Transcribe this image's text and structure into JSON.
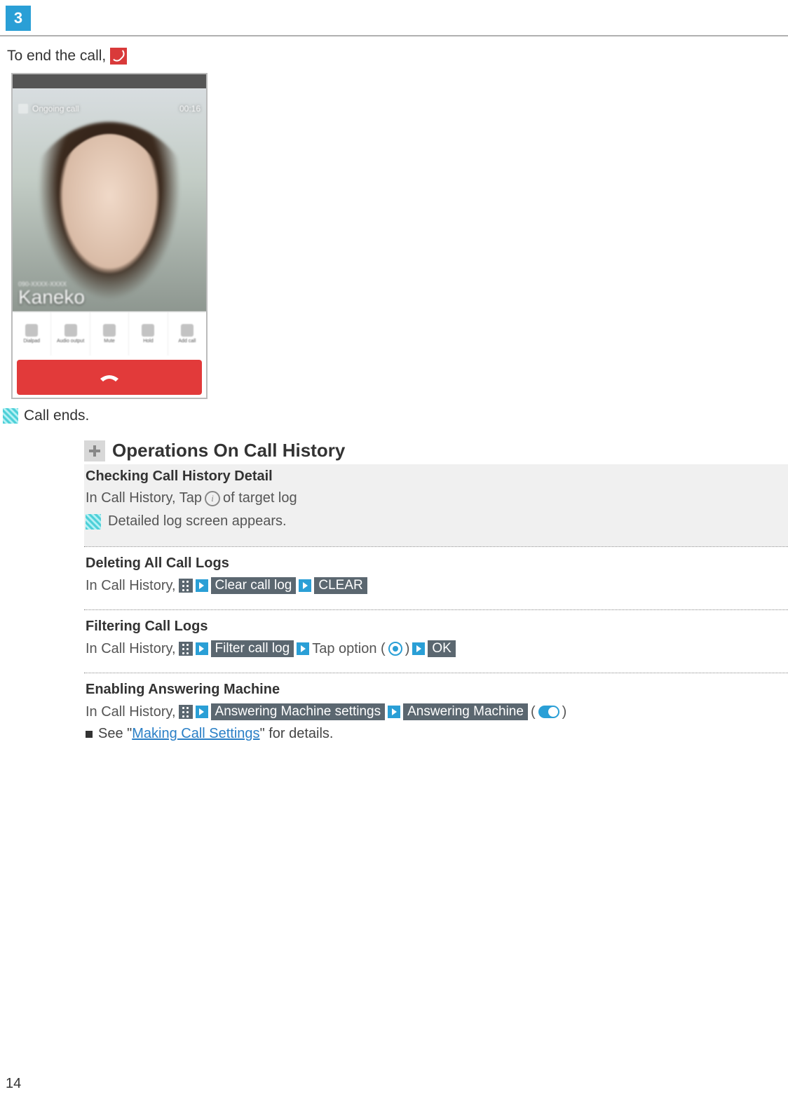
{
  "step": {
    "number": "3"
  },
  "line1": {
    "prefix": "To end the call, "
  },
  "phone": {
    "status_left": "Ongoing call",
    "status_right": "00:16",
    "number": "090-XXXX-XXXX",
    "name": "Kaneko",
    "toolbar": [
      "Dialpad",
      "Audio output",
      "Mute",
      "Hold",
      "Add call"
    ]
  },
  "result1": "Call ends.",
  "section_title": "Operations On Call History",
  "blocks": {
    "b1": {
      "h": "Checking Call History Detail",
      "l1a": "In Call History, Tap ",
      "l1b": " of target log",
      "res": "Detailed log screen appears."
    },
    "b2": {
      "h": "Deleting All Call Logs",
      "l1": "In Call History, ",
      "chip1": "Clear call log",
      "chip2": "CLEAR"
    },
    "b3": {
      "h": "Filtering Call Logs",
      "l1": "In Call History, ",
      "chip1": "Filter call log",
      "mid": " Tap option (",
      "close": ")",
      "chip2": "OK"
    },
    "b4": {
      "h": "Enabling Answering Machine",
      "l1": "In Call History, ",
      "chip1": "Answering Machine settings",
      "chip2": "Answering Machine",
      "paren_open": " (",
      "paren_close": ")",
      "note_a": "See \"",
      "note_link": "Making Call Settings",
      "note_b": "\" for details."
    }
  },
  "page_number": "14"
}
